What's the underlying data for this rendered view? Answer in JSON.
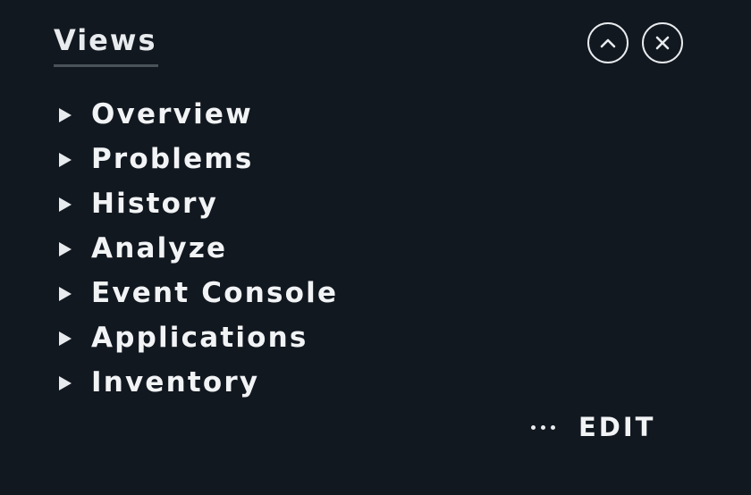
{
  "header": {
    "title": "Views",
    "collapse_icon": "chevron-up-circle-icon",
    "close_icon": "close-circle-icon"
  },
  "menu": {
    "items": [
      {
        "label": "Overview"
      },
      {
        "label": "Problems"
      },
      {
        "label": "History"
      },
      {
        "label": "Analyze"
      },
      {
        "label": "Event Console"
      },
      {
        "label": "Applications"
      },
      {
        "label": "Inventory"
      }
    ]
  },
  "footer": {
    "more_icon": "more-dots-icon",
    "edit_label": "EDIT"
  },
  "colors": {
    "background": "#121820",
    "text": "#e8ebee",
    "underline": "#4a525a"
  }
}
